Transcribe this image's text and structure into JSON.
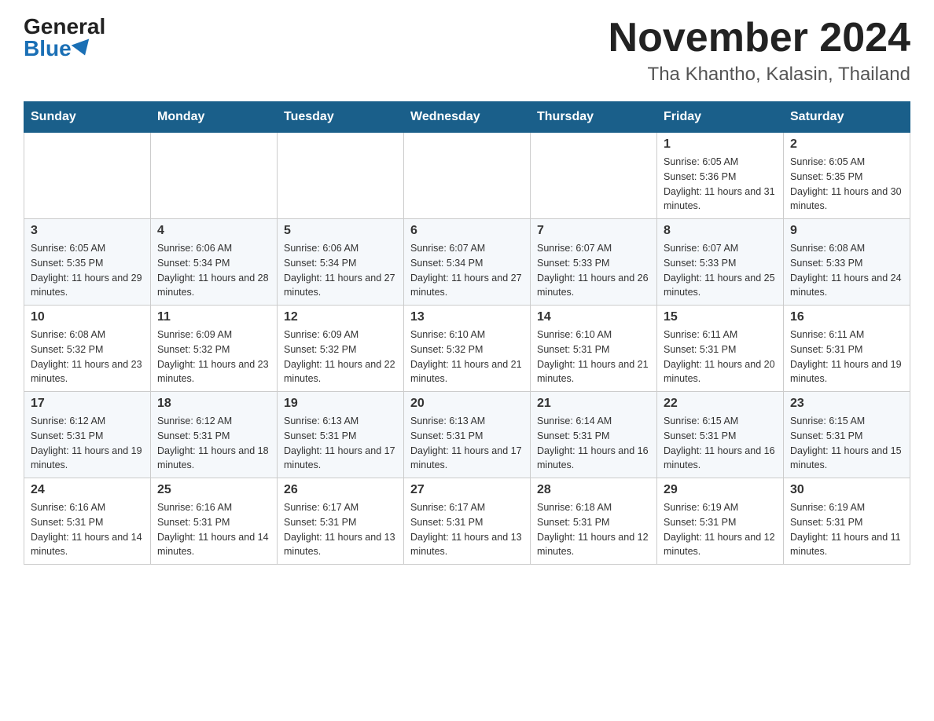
{
  "header": {
    "logo_general": "General",
    "logo_blue": "Blue",
    "main_title": "November 2024",
    "subtitle": "Tha Khantho, Kalasin, Thailand"
  },
  "days_of_week": [
    "Sunday",
    "Monday",
    "Tuesday",
    "Wednesday",
    "Thursday",
    "Friday",
    "Saturday"
  ],
  "weeks": [
    [
      {
        "day": "",
        "info": ""
      },
      {
        "day": "",
        "info": ""
      },
      {
        "day": "",
        "info": ""
      },
      {
        "day": "",
        "info": ""
      },
      {
        "day": "",
        "info": ""
      },
      {
        "day": "1",
        "info": "Sunrise: 6:05 AM\nSunset: 5:36 PM\nDaylight: 11 hours and 31 minutes."
      },
      {
        "day": "2",
        "info": "Sunrise: 6:05 AM\nSunset: 5:35 PM\nDaylight: 11 hours and 30 minutes."
      }
    ],
    [
      {
        "day": "3",
        "info": "Sunrise: 6:05 AM\nSunset: 5:35 PM\nDaylight: 11 hours and 29 minutes."
      },
      {
        "day": "4",
        "info": "Sunrise: 6:06 AM\nSunset: 5:34 PM\nDaylight: 11 hours and 28 minutes."
      },
      {
        "day": "5",
        "info": "Sunrise: 6:06 AM\nSunset: 5:34 PM\nDaylight: 11 hours and 27 minutes."
      },
      {
        "day": "6",
        "info": "Sunrise: 6:07 AM\nSunset: 5:34 PM\nDaylight: 11 hours and 27 minutes."
      },
      {
        "day": "7",
        "info": "Sunrise: 6:07 AM\nSunset: 5:33 PM\nDaylight: 11 hours and 26 minutes."
      },
      {
        "day": "8",
        "info": "Sunrise: 6:07 AM\nSunset: 5:33 PM\nDaylight: 11 hours and 25 minutes."
      },
      {
        "day": "9",
        "info": "Sunrise: 6:08 AM\nSunset: 5:33 PM\nDaylight: 11 hours and 24 minutes."
      }
    ],
    [
      {
        "day": "10",
        "info": "Sunrise: 6:08 AM\nSunset: 5:32 PM\nDaylight: 11 hours and 23 minutes."
      },
      {
        "day": "11",
        "info": "Sunrise: 6:09 AM\nSunset: 5:32 PM\nDaylight: 11 hours and 23 minutes."
      },
      {
        "day": "12",
        "info": "Sunrise: 6:09 AM\nSunset: 5:32 PM\nDaylight: 11 hours and 22 minutes."
      },
      {
        "day": "13",
        "info": "Sunrise: 6:10 AM\nSunset: 5:32 PM\nDaylight: 11 hours and 21 minutes."
      },
      {
        "day": "14",
        "info": "Sunrise: 6:10 AM\nSunset: 5:31 PM\nDaylight: 11 hours and 21 minutes."
      },
      {
        "day": "15",
        "info": "Sunrise: 6:11 AM\nSunset: 5:31 PM\nDaylight: 11 hours and 20 minutes."
      },
      {
        "day": "16",
        "info": "Sunrise: 6:11 AM\nSunset: 5:31 PM\nDaylight: 11 hours and 19 minutes."
      }
    ],
    [
      {
        "day": "17",
        "info": "Sunrise: 6:12 AM\nSunset: 5:31 PM\nDaylight: 11 hours and 19 minutes."
      },
      {
        "day": "18",
        "info": "Sunrise: 6:12 AM\nSunset: 5:31 PM\nDaylight: 11 hours and 18 minutes."
      },
      {
        "day": "19",
        "info": "Sunrise: 6:13 AM\nSunset: 5:31 PM\nDaylight: 11 hours and 17 minutes."
      },
      {
        "day": "20",
        "info": "Sunrise: 6:13 AM\nSunset: 5:31 PM\nDaylight: 11 hours and 17 minutes."
      },
      {
        "day": "21",
        "info": "Sunrise: 6:14 AM\nSunset: 5:31 PM\nDaylight: 11 hours and 16 minutes."
      },
      {
        "day": "22",
        "info": "Sunrise: 6:15 AM\nSunset: 5:31 PM\nDaylight: 11 hours and 16 minutes."
      },
      {
        "day": "23",
        "info": "Sunrise: 6:15 AM\nSunset: 5:31 PM\nDaylight: 11 hours and 15 minutes."
      }
    ],
    [
      {
        "day": "24",
        "info": "Sunrise: 6:16 AM\nSunset: 5:31 PM\nDaylight: 11 hours and 14 minutes."
      },
      {
        "day": "25",
        "info": "Sunrise: 6:16 AM\nSunset: 5:31 PM\nDaylight: 11 hours and 14 minutes."
      },
      {
        "day": "26",
        "info": "Sunrise: 6:17 AM\nSunset: 5:31 PM\nDaylight: 11 hours and 13 minutes."
      },
      {
        "day": "27",
        "info": "Sunrise: 6:17 AM\nSunset: 5:31 PM\nDaylight: 11 hours and 13 minutes."
      },
      {
        "day": "28",
        "info": "Sunrise: 6:18 AM\nSunset: 5:31 PM\nDaylight: 11 hours and 12 minutes."
      },
      {
        "day": "29",
        "info": "Sunrise: 6:19 AM\nSunset: 5:31 PM\nDaylight: 11 hours and 12 minutes."
      },
      {
        "day": "30",
        "info": "Sunrise: 6:19 AM\nSunset: 5:31 PM\nDaylight: 11 hours and 11 minutes."
      }
    ]
  ]
}
